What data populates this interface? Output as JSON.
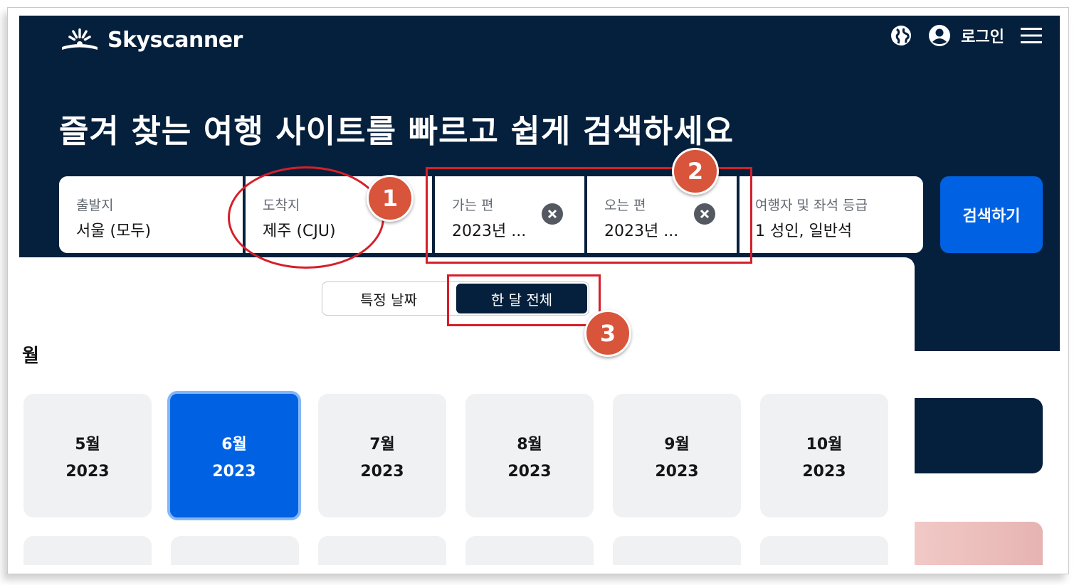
{
  "header": {
    "brand": "Skyscanner",
    "login_label": "로그인",
    "icons": [
      "globe-icon",
      "account-icon",
      "menu-icon"
    ]
  },
  "hero": {
    "headline": "즐겨 찾는 여행 사이트를 빠르고 쉽게 검색하세요"
  },
  "search": {
    "origin": {
      "label": "출발지",
      "value": "서울 (모두)"
    },
    "destination": {
      "label": "도착지",
      "value": "제주 (CJU)"
    },
    "depart": {
      "label": "가는 편",
      "value": "2023년 ..."
    },
    "return": {
      "label": "오는 편",
      "value": "2023년 ..."
    },
    "travellers": {
      "label": "여행자 및 좌석 등급",
      "value": "1 성인, 일반석"
    },
    "submit_label": "검색하기"
  },
  "date_picker": {
    "toggle": {
      "specific": "특정 날짜",
      "whole_month": "한 달 전체",
      "active": "whole_month"
    },
    "section_title": "월",
    "months": [
      {
        "name": "5월",
        "year": "2023",
        "selected": false
      },
      {
        "name": "6월",
        "year": "2023",
        "selected": true
      },
      {
        "name": "7월",
        "year": "2023",
        "selected": false
      },
      {
        "name": "8월",
        "year": "2023",
        "selected": false
      },
      {
        "name": "9월",
        "year": "2023",
        "selected": false
      },
      {
        "name": "10월",
        "year": "2023",
        "selected": false
      }
    ]
  },
  "annotations": {
    "badge_1": "1",
    "badge_2": "2",
    "badge_3": "3",
    "color": "#d51f2a"
  },
  "colors": {
    "navy": "#05203c",
    "brand_blue": "#0062e3",
    "card_grey": "#eff1f2"
  }
}
